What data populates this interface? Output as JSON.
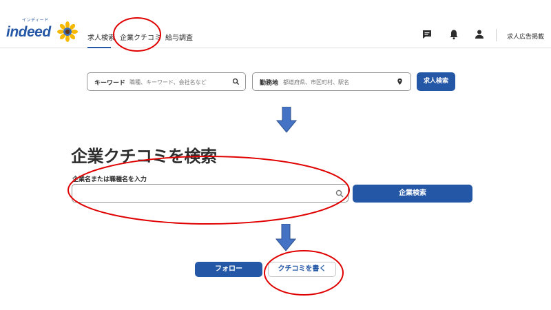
{
  "header": {
    "logo_ruby": "インディード",
    "logo_text": "indeed",
    "nav": [
      "求人検索",
      "企業クチコミ",
      "給与調査"
    ],
    "active_nav": "求人検索",
    "employer_link": "求人広告掲載",
    "icons": [
      "message-icon",
      "bell-icon",
      "user-icon"
    ]
  },
  "job_search": {
    "keyword_label": "キーワード",
    "keyword_placeholder": "職種、キーワード、会社名など",
    "location_label": "勤務地",
    "location_placeholder": "都道府県、市区町村、駅名",
    "search_button": "求人検索"
  },
  "company_search": {
    "title": "企業クチコミを検索",
    "input_label": "企業名または職種名を入力",
    "input_value": "",
    "search_button": "企業検索"
  },
  "actions": {
    "follow_button": "フォロー",
    "write_review_button": "クチコミを書く"
  },
  "colors": {
    "brand_blue": "#2557a7",
    "arrow_blue": "#4472c4",
    "annotation_red": "#e00000"
  }
}
